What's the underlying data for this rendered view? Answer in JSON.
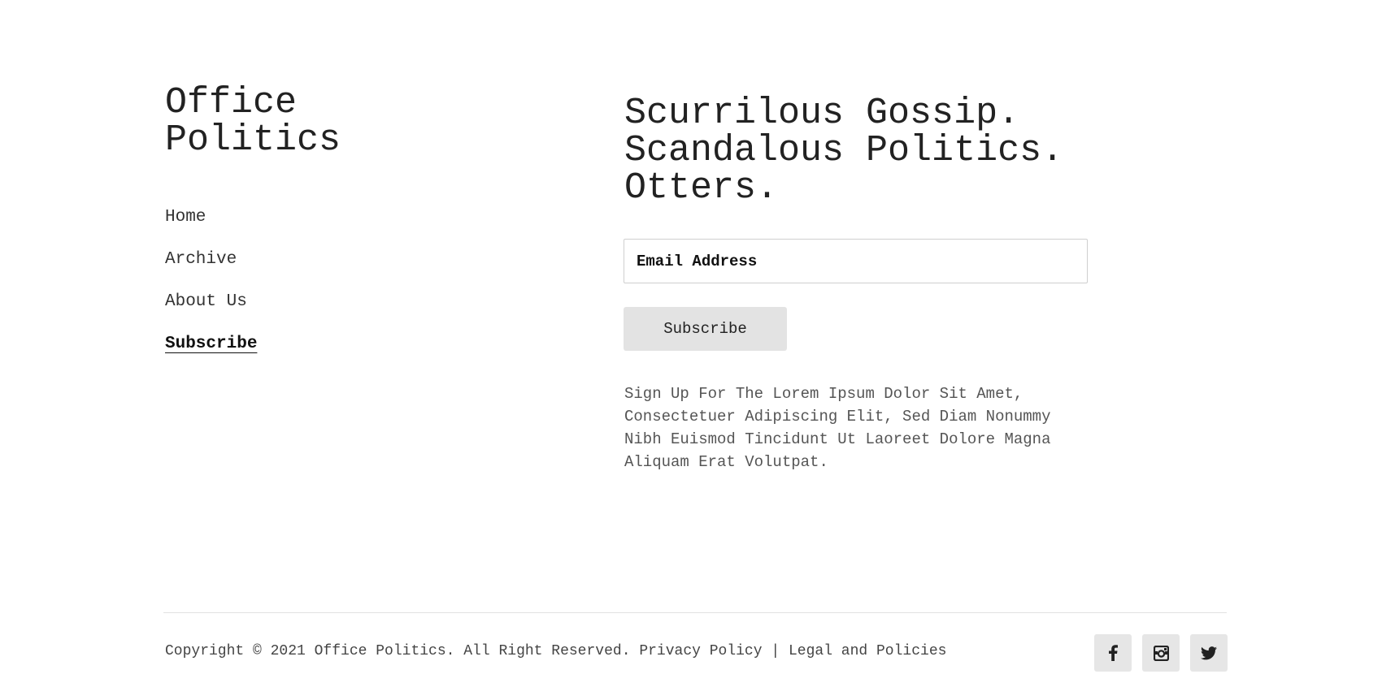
{
  "brand": {
    "line1": "Office",
    "line2": "Politics"
  },
  "nav": {
    "items": [
      {
        "label": "Home",
        "active": false
      },
      {
        "label": "Archive",
        "active": false
      },
      {
        "label": "About Us",
        "active": false
      },
      {
        "label": "Subscribe",
        "active": true
      }
    ]
  },
  "hero": {
    "headline_lines": [
      "Scurrilous Gossip.",
      "Scandalous Politics.",
      "Otters."
    ],
    "email_placeholder": "Email Address",
    "email_value": "",
    "subscribe_label": "Subscribe",
    "blurb": "Sign Up For The Lorem Ipsum Dolor Sit Amet, Consectetuer Adipiscing Elit, Sed Diam Nonummy Nibh Euismod Tincidunt Ut Laoreet Dolore Magna Aliquam Erat Volutpat."
  },
  "footer": {
    "copyright": "Copyright © 2021 Office Politics. All Right Reserved.",
    "privacy_link": "Privacy Policy",
    "separator": "|",
    "legal_link": "Legal and Policies",
    "socials": [
      {
        "icon": "facebook-icon"
      },
      {
        "icon": "instagram-icon"
      },
      {
        "icon": "twitter-icon"
      }
    ]
  },
  "colors": {
    "text": "#222222",
    "muted_text": "#555555",
    "button_bg": "#e3e3e3",
    "social_bg": "#e6e6e6",
    "rule": "#e2e2e2"
  }
}
